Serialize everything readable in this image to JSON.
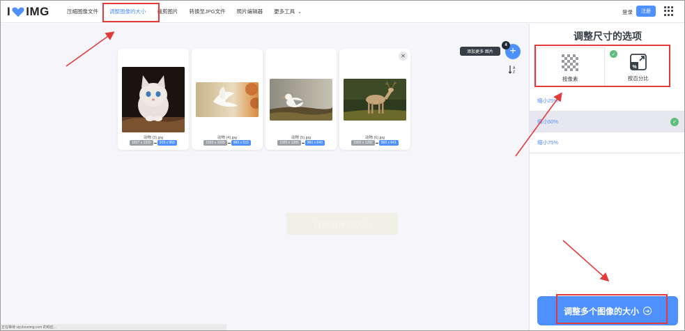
{
  "header": {
    "logo_left": "I",
    "logo_right": "IMG",
    "nav": [
      {
        "label": "压缩图像文件",
        "active": false
      },
      {
        "label": "调整图像的大小",
        "active": true
      },
      {
        "label": "裁剪图片",
        "active": false
      },
      {
        "label": "转换至JPG文件",
        "active": false
      },
      {
        "label": "照片编辑器",
        "active": false
      },
      {
        "label": "更多工具",
        "active": false
      }
    ],
    "login": "登录",
    "signup": "注册"
  },
  "workspace": {
    "add_tooltip": "添加更多 图片",
    "file_count": "4",
    "files": [
      {
        "name": "动物 (3).jpg",
        "orig": "1837 x 1920",
        "new": "919 x 960"
      },
      {
        "name": "动物 (4).jpg",
        "orig": "1920 x 1065",
        "new": "960 x 533"
      },
      {
        "name": "动物 (5).jpg",
        "orig": "1920 x 1280",
        "new": "960 x 640"
      },
      {
        "name": "动物 (6).jpg",
        "orig": "1920 x 1282",
        "new": "960 x 641"
      }
    ],
    "ghost_button": "调整图像的大小",
    "status_text": "正在等待 vip.iloveimg.com 的响应..."
  },
  "sidebar": {
    "title": "调整尺寸的选项",
    "modes": [
      {
        "label": "按像素",
        "selected": false
      },
      {
        "label": "按百分比",
        "selected": true
      }
    ],
    "options": [
      {
        "label": "缩小25%",
        "selected": false
      },
      {
        "label": "缩小50%",
        "selected": true
      },
      {
        "label": "缩小75%",
        "selected": false
      }
    ],
    "action_button": "调整多个图像的大小"
  },
  "colors": {
    "accent": "#4d90fe",
    "check": "#5fbe7e",
    "annotation": "#e23b3b",
    "workspace_bg": "#f5f5fa"
  }
}
